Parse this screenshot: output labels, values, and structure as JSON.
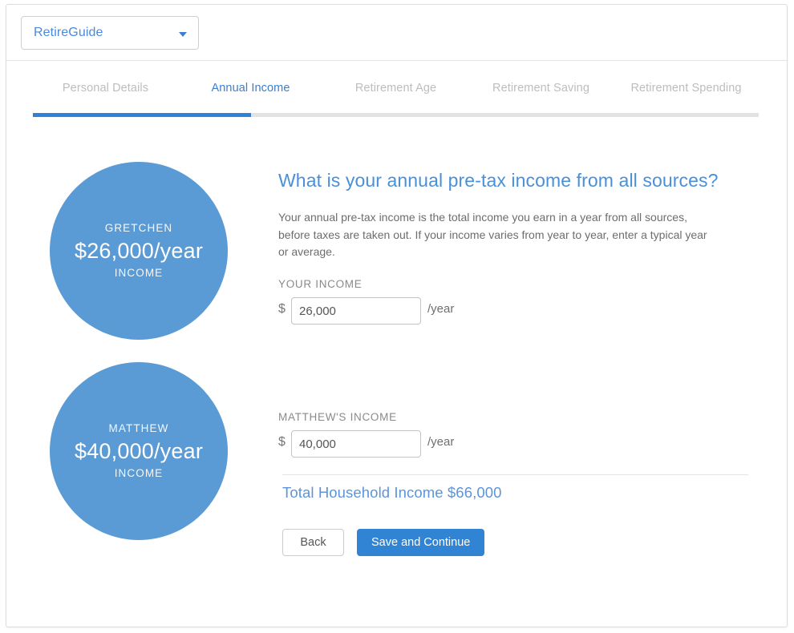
{
  "header": {
    "app_select_label": "RetireGuide",
    "caret_icon": "chevron-down-icon"
  },
  "tabs": [
    {
      "label": "Personal Details",
      "active": false
    },
    {
      "label": "Annual Income",
      "active": true
    },
    {
      "label": "Retirement Age",
      "active": false
    },
    {
      "label": "Retirement Saving",
      "active": false
    },
    {
      "label": "Retirement Spending",
      "active": false
    }
  ],
  "progress": {
    "percent": 30,
    "fill_color": "#2f80d8",
    "track_color": "#e2e2e2"
  },
  "circles": [
    {
      "name": "GRETCHEN",
      "value": "$26,000/year",
      "caption": "INCOME",
      "color": "#5b9bd5"
    },
    {
      "name": "MATTHEW",
      "value": "$40,000/year",
      "caption": "INCOME",
      "color": "#5b9bd5"
    }
  ],
  "main": {
    "heading": "What is your annual pre-tax income from all sources?",
    "body": "Your annual pre-tax income is the total income you earn in a year from all sources, before taxes are taken out. If your income varies from year to year, enter a typical year or average.",
    "heading_color": "#4a90d9",
    "fields": [
      {
        "label": "YOUR INCOME",
        "currency": "$",
        "value": "26,000",
        "placeholder": "0",
        "suffix": "/year"
      },
      {
        "label": "MATTHEW'S INCOME",
        "currency": "$",
        "value": "40,000",
        "placeholder": "0",
        "suffix": "/year"
      }
    ],
    "total_label": "Total Household Income $66,000",
    "total_color": "#5b95d8"
  },
  "actions": {
    "back_label": "Back",
    "continue_label": "Save and Continue",
    "primary_color": "#3183d4"
  }
}
